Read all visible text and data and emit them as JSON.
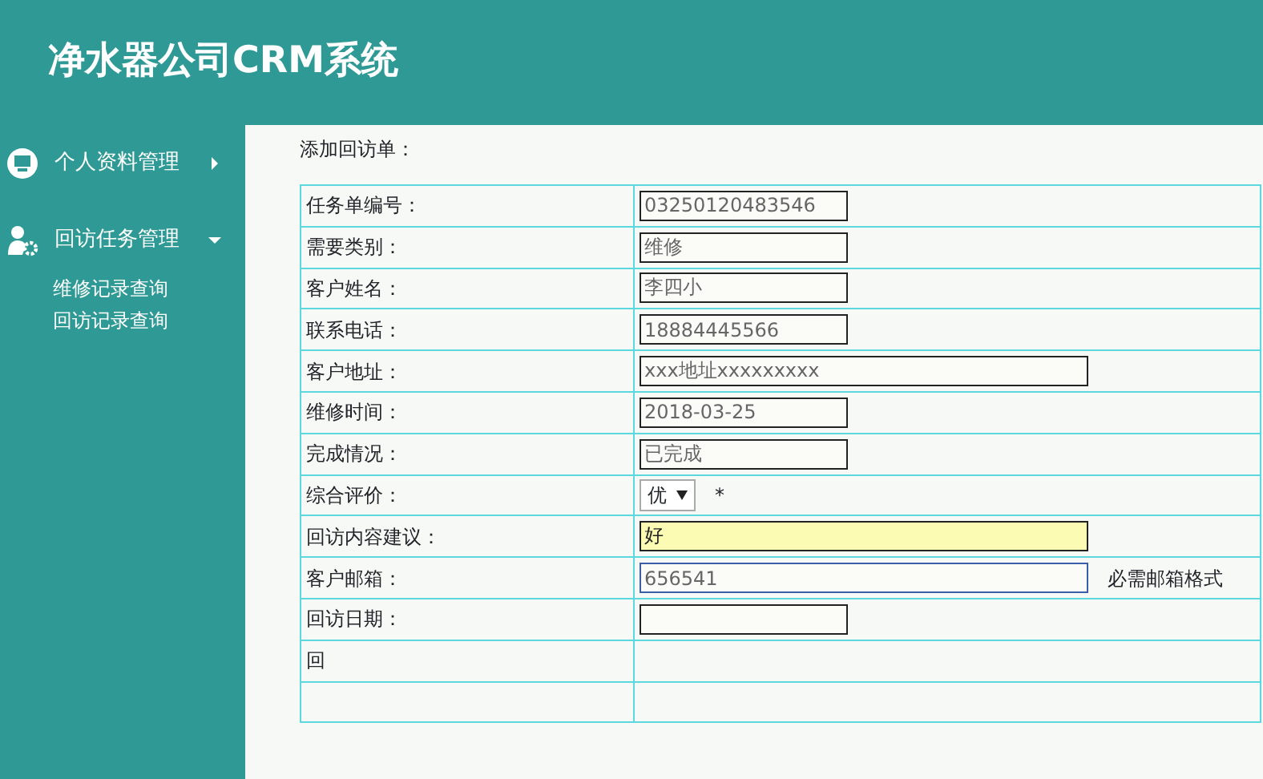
{
  "header": {
    "title": "净水器公司CRM系统"
  },
  "sidebar": {
    "items": [
      {
        "label": "个人资料管理",
        "expanded": false
      },
      {
        "label": "回访任务管理",
        "expanded": true,
        "children": [
          {
            "label": "维修记录查询"
          },
          {
            "label": "回访记录查询"
          }
        ]
      }
    ]
  },
  "form": {
    "title": "添加回访单：",
    "rows": [
      {
        "label": "任务单编号：",
        "kind": "input",
        "value": "03250120483546",
        "wide": false
      },
      {
        "label": "需要类别：",
        "kind": "input",
        "value": "维修",
        "wide": false
      },
      {
        "label": "客户姓名：",
        "kind": "input",
        "value": "李四小",
        "wide": false
      },
      {
        "label": "联系电话：",
        "kind": "input",
        "value": "18884445566",
        "wide": false
      },
      {
        "label": "客户地址：",
        "kind": "input",
        "value": "xxx地址xxxxxxxxx",
        "wide": true
      },
      {
        "label": "维修时间：",
        "kind": "input",
        "value": "2018-03-25",
        "wide": false
      },
      {
        "label": "完成情况：",
        "kind": "input",
        "value": "已完成",
        "wide": false
      },
      {
        "label": "综合评价：",
        "kind": "select",
        "value": "优",
        "note": "*"
      },
      {
        "label": "回访内容建议：",
        "kind": "input",
        "value": "好",
        "wide": true,
        "highlighted": true
      },
      {
        "label": "客户邮箱：",
        "kind": "input",
        "value": "656541",
        "wide": true,
        "focused": true,
        "note": "必需邮箱格式"
      },
      {
        "label": "回访日期：",
        "kind": "input",
        "wide": false
      },
      {
        "label": "回",
        "kind": "blank"
      },
      {
        "kind": "blank"
      }
    ]
  }
}
